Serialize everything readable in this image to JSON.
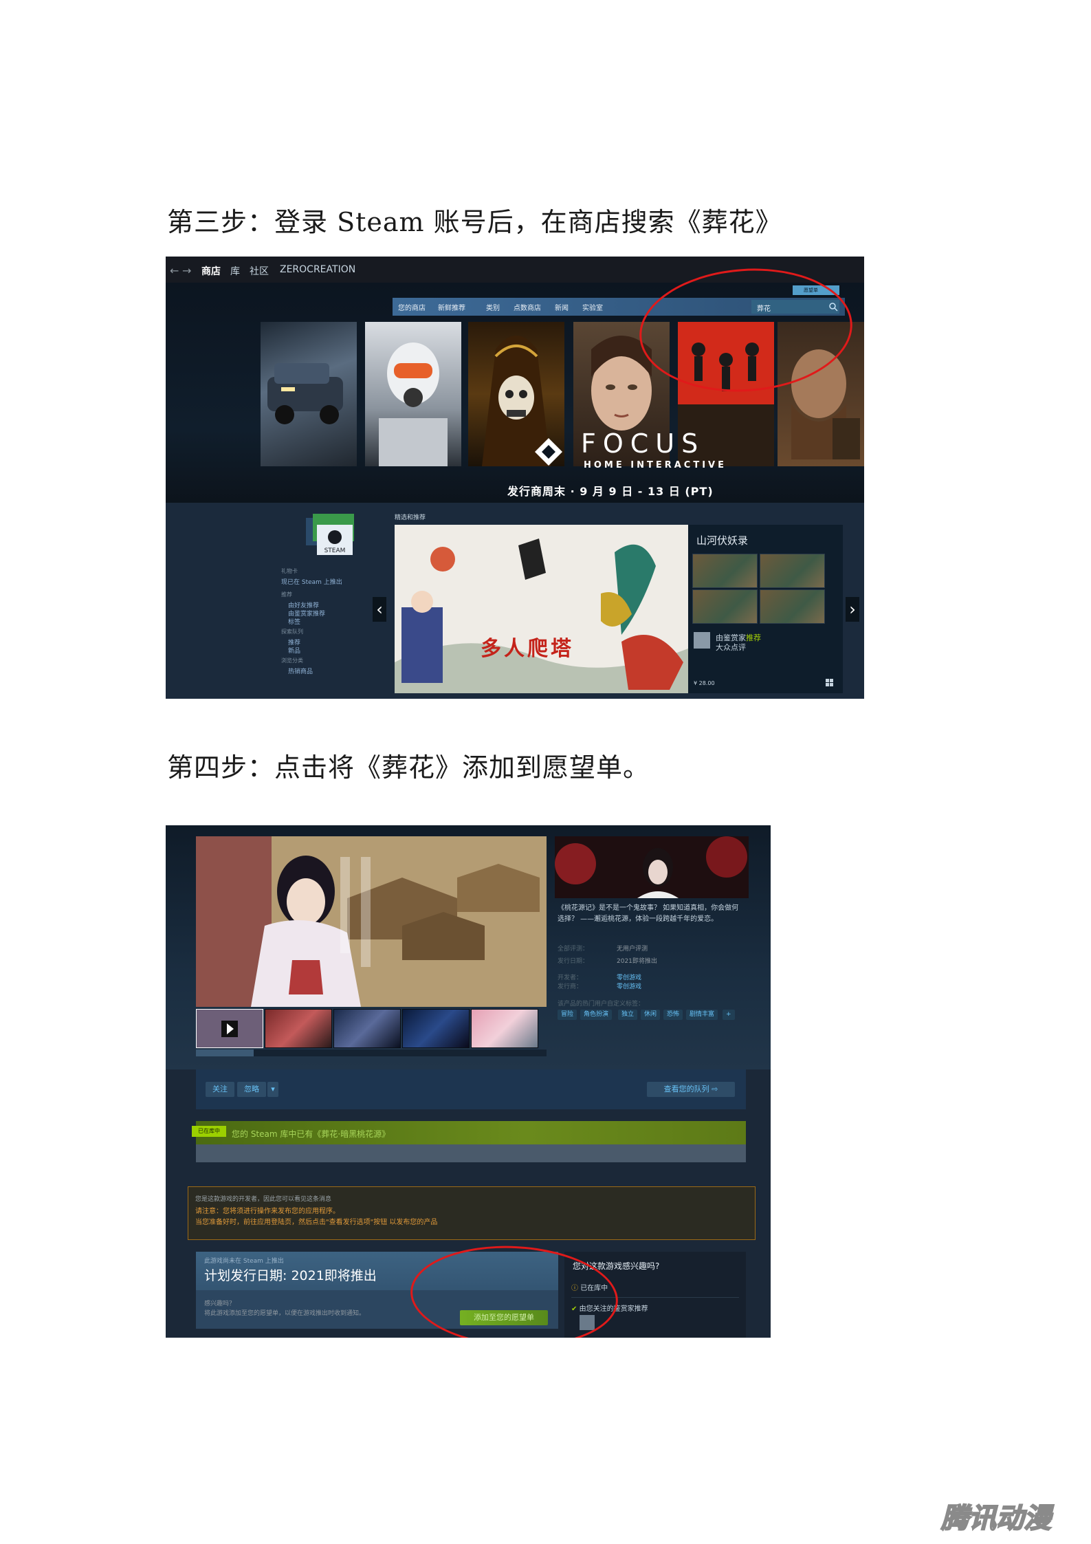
{
  "step3": {
    "text": "第三步：登录 Steam 账号后，在商店搜索《葬花》"
  },
  "step4": {
    "text": "第四步：点击将《葬花》添加到愿望单。"
  },
  "store": {
    "topnav": {
      "back": "←",
      "forward": "→",
      "store": "商店",
      "library": "库",
      "community": "社区",
      "username": "ZEROCREATION"
    },
    "subnav": [
      "您的商店",
      "新鲜推荐",
      "类别",
      "点数商店",
      "新闻",
      "实验室"
    ],
    "search_value": "葬花",
    "wishlist_button": "愿望单",
    "banner": {
      "brand": "FOCUS",
      "brand_sub": "HOME INTERACTIVE",
      "promo": "发行商周末 · 9 月 9 日 - 13 日 (PT)"
    },
    "sidebar": {
      "gift_card_heading": "礼物卡",
      "gift_card_link": "现已在 Steam 上推出",
      "recommended_heading": "推荐",
      "recommended": [
        "由好友推荐",
        "由鉴赏家推荐",
        "标签"
      ],
      "queue_heading": "探索队列",
      "queue": [
        "推荐",
        "新品"
      ],
      "browse_heading": "浏览分类",
      "browse": [
        "热销商品"
      ]
    },
    "featured_heading": "精选和推荐",
    "featured": {
      "title": "山河伏妖录",
      "art_title": "多人爬塔",
      "recommend_line1_pre": "由鉴赏家",
      "recommend_line1_highlight": "推荐",
      "recommend_line2": "大众点评",
      "price": "¥ 28.00"
    }
  },
  "game_page": {
    "description": "《桃花源记》是不是一个鬼故事？ 如果知道真相，你会做何选择？ ——邂逅桃花源，体验一段跨越千年的爱恋。",
    "meta": [
      {
        "label": "全部评测：",
        "value": "无用户评测"
      },
      {
        "label": "发行日期：",
        "value": "2021即将推出"
      },
      {
        "label": "开发者：",
        "value": "零创游戏"
      },
      {
        "label": "发行商：",
        "value": "零创游戏"
      }
    ],
    "tags_label": "该产品的热门用户自定义标签：",
    "tags": [
      "冒险",
      "角色扮演",
      "独立",
      "休闲",
      "恐怖",
      "剧情丰富",
      "+"
    ],
    "follow_button": "关注",
    "ignore_button": "忽略",
    "queue_button": "查看您的队列",
    "owned_badge": "已在库中",
    "owned_text": "您的 Steam 库中已有《葬花·暗黑桃花源》",
    "dev_notice": {
      "line1": "您是这款游戏的开发者，因此您可以看见这条消息",
      "line2": "请注意：您将须进行操作来发布您的应用程序。",
      "line3": "当您准备好时，前往应用登陆页，然后点击\"查看发行选项\"按钮 以发布您的产品"
    },
    "release": {
      "small": "此游戏尚未在 Steam 上推出",
      "big": "计划发行日期: 2021即将推出",
      "interest": "感兴趣吗？",
      "interest_sub": "将此游戏添加至您的愿望单，以便在游戏推出时收到通知。",
      "add_button": "添加至您的愿望单"
    },
    "interest_panel": {
      "title": "您对这款游戏感兴趣吗?",
      "in_library": "已在库中",
      "curator": "由您关注的鉴赏家推荐"
    }
  },
  "watermark": {
    "text": "腾讯动漫"
  },
  "colors": {
    "annotation": "#e01a1a",
    "steam_dark": "#1b2838",
    "accent_green": "#75b022",
    "link_blue": "#67c1f5"
  }
}
